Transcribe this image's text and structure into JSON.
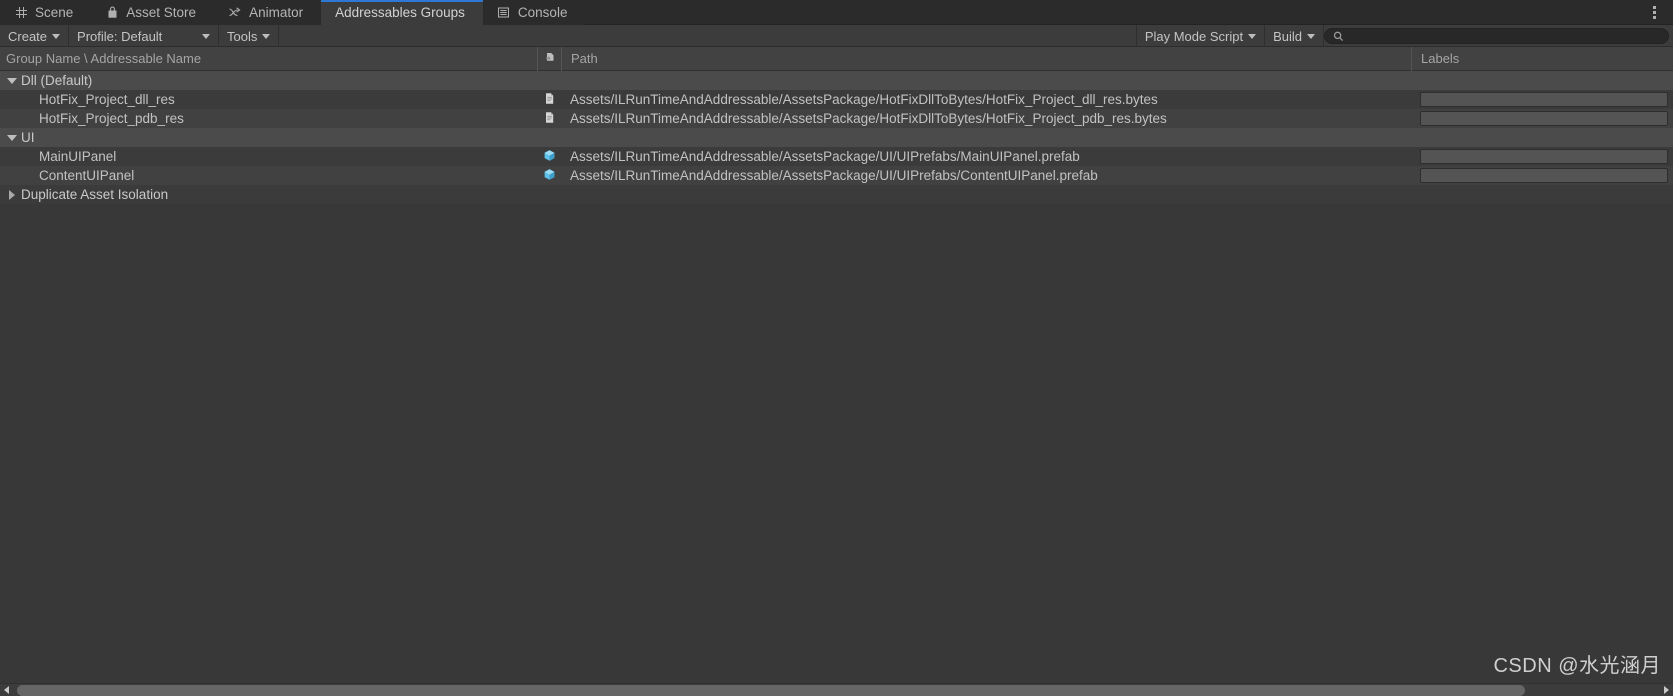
{
  "window": {
    "title": "Addressables Groups",
    "kebab_icon": "kebab-menu-icon"
  },
  "tabs": [
    {
      "label": "Scene",
      "icon": "grid-icon",
      "glyph": "⌗",
      "active": false
    },
    {
      "label": "Asset Store",
      "icon": "store-bag-icon",
      "glyph": "ὬD",
      "active": false
    },
    {
      "label": "Animator",
      "icon": "animator-icon",
      "glyph": "↠",
      "active": false
    },
    {
      "label": "Addressables Groups",
      "icon": "none",
      "glyph": "",
      "active": true
    },
    {
      "label": "Console",
      "icon": "console-icon",
      "glyph": "☰",
      "active": false
    }
  ],
  "toolbar": {
    "create_label": "Create",
    "profile_label": "Profile: Default",
    "tools_label": "Tools",
    "play_mode_script_label": "Play Mode Script",
    "build_label": "Build",
    "search_placeholder": "",
    "search_value": "",
    "search_icon": "search-icon"
  },
  "columns": {
    "name": "Group Name \\ Addressable Name",
    "type_icon": "asset-type-icon",
    "path": "Path",
    "labels": "Labels"
  },
  "tree": [
    {
      "kind": "group",
      "name": "Dll (Default)",
      "expanded": true,
      "foldout": "chevron-down-icon",
      "path": "",
      "labels": null,
      "icon": null
    },
    {
      "kind": "asset",
      "name": "HotFix_Project_dll_res",
      "path": "Assets/ILRunTimeAndAddressable/AssetsPackage/HotFixDllToBytes/HotFix_Project_dll_res.bytes",
      "icon": "text-asset-icon",
      "labels": ""
    },
    {
      "kind": "asset",
      "name": "HotFix_Project_pdb_res",
      "path": "Assets/ILRunTimeAndAddressable/AssetsPackage/HotFixDllToBytes/HotFix_Project_pdb_res.bytes",
      "icon": "text-asset-icon",
      "labels": ""
    },
    {
      "kind": "group",
      "name": "UI",
      "expanded": true,
      "foldout": "chevron-down-icon",
      "path": "",
      "labels": null,
      "icon": null
    },
    {
      "kind": "asset",
      "name": "MainUIPanel",
      "path": "Assets/ILRunTimeAndAddressable/AssetsPackage/UI/UIPrefabs/MainUIPanel.prefab",
      "icon": "prefab-cube-icon",
      "labels": ""
    },
    {
      "kind": "asset",
      "name": "ContentUIPanel",
      "path": "Assets/ILRunTimeAndAddressable/AssetsPackage/UI/UIPrefabs/ContentUIPanel.prefab",
      "icon": "prefab-cube-icon",
      "labels": ""
    },
    {
      "kind": "group-collapsed",
      "name": "Duplicate Asset Isolation",
      "expanded": false,
      "foldout": "chevron-right-icon",
      "path": "",
      "labels": null,
      "icon": null
    }
  ],
  "scrollbar": {
    "left_arrow": "arrow-left-icon",
    "right_arrow": "arrow-right-icon"
  },
  "watermark": "CSDN @水光涵月",
  "colors": {
    "accent": "#2c78d3",
    "window_bg": "#383838",
    "tabbar_bg": "#2b2b2b",
    "toolbar_bg": "#3c3c3c",
    "group_row": "#4b4b4b",
    "prefab_icon": "#5fc0e8",
    "text": "#c2c2c2"
  }
}
